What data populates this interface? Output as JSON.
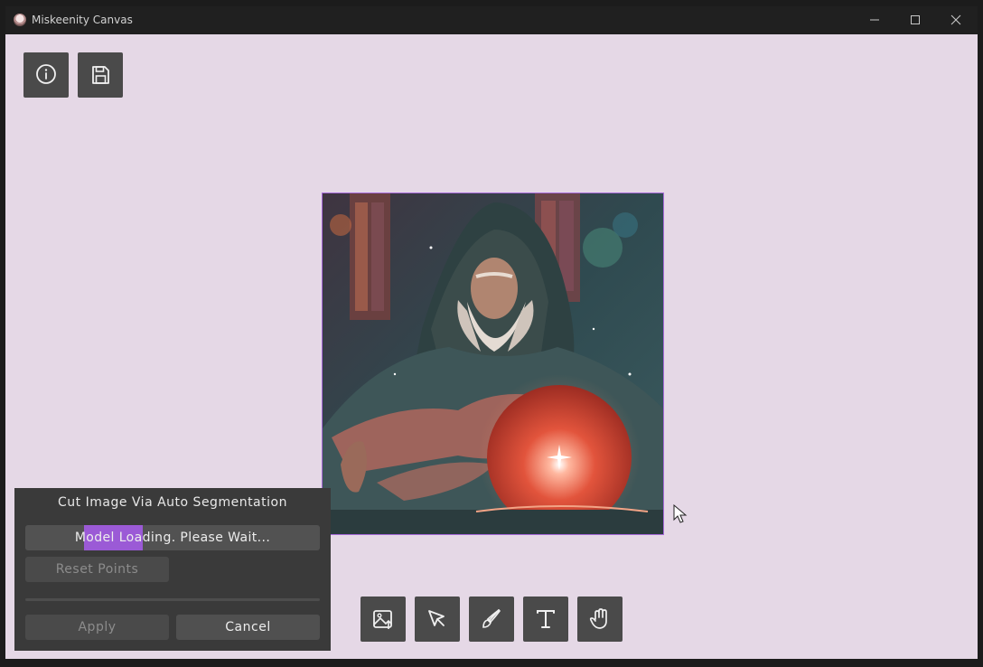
{
  "window": {
    "title": "Miskeenity Canvas",
    "controls": [
      "minimize-icon",
      "maximize-icon",
      "close-icon"
    ]
  },
  "top_toolbar": {
    "buttons": [
      {
        "name": "info-button",
        "icon": "info-icon"
      },
      {
        "name": "save-button",
        "icon": "save-icon"
      }
    ]
  },
  "canvas": {
    "background": "#e5d8e6",
    "image": {
      "subject": "hooded wizard with glowing red crystal ball",
      "selected_border_color": "#a56ad8"
    }
  },
  "segmentation_panel": {
    "title": "Cut Image Via Auto Segmentation",
    "status": "Model Loading. Please Wait...",
    "reset_points_label": "Reset Points",
    "apply_label": "Apply",
    "cancel_label": "Cancel",
    "accent": "#9b5ad6"
  },
  "bottom_toolbar": {
    "buttons": [
      {
        "name": "add-image-button",
        "icon": "image-add-icon"
      },
      {
        "name": "select-button",
        "icon": "pointer-icon"
      },
      {
        "name": "brush-button",
        "icon": "brush-icon"
      },
      {
        "name": "text-button",
        "icon": "text-icon"
      },
      {
        "name": "pan-button",
        "icon": "hand-icon"
      }
    ]
  }
}
